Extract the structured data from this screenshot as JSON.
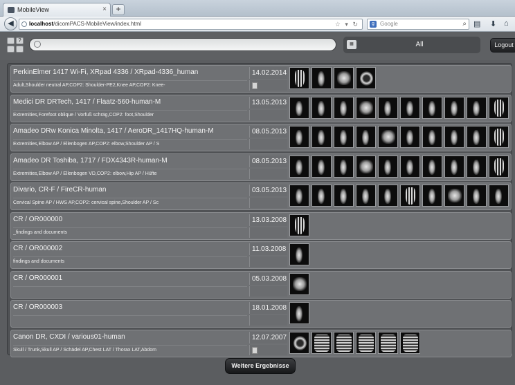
{
  "browser": {
    "tab_title": "MobileView",
    "tab_close": "×",
    "new_tab": "+",
    "url_host": "localhost",
    "url_path": "/dicomPACS-MobileView/index.html",
    "search_engine_label": "Google",
    "search_engine_icon": "google-icon"
  },
  "header": {
    "filter_label": "All",
    "logout_label": "Logout",
    "search_placeholder": ""
  },
  "studies": [
    {
      "title": "PerkinElmer 1417 Wi-Fi, XRpad 4336 / XRpad-4336_human",
      "description": "Adult,Shoulder neutral AP,COP2: Shoulder-PE2,Knee AP,COP2: Knee-",
      "date": "14.02.2014",
      "thumbnails": [
        "hand",
        "knee",
        "shoulder",
        "skull"
      ],
      "has_tag": true
    },
    {
      "title": "Medici DR DRTech, 1417 / Flaatz-560-human-M",
      "description": "Extremities,Forefoot oblique / Vorfuß schräg,COP2: foot,Shoulder",
      "date": "13.05.2013",
      "thumbnails": [
        "bone",
        "bone",
        "bone",
        "foot",
        "bone",
        "bone",
        "bone",
        "bone",
        "bone",
        "hand"
      ],
      "has_tag": false
    },
    {
      "title": "Amadeo DRw Konica Minolta, 1417 / AeroDR_1417HQ-human-M",
      "description": "Extremities,Elbow AP / Ellenbogen AP,COP2: elbow,Shoulder AP / S",
      "date": "08.05.2013",
      "thumbnails": [
        "bone",
        "bone",
        "bone",
        "bone",
        "foot",
        "bone",
        "bone",
        "bone",
        "bone",
        "hand"
      ],
      "has_tag": false
    },
    {
      "title": "Amadeo DR Toshiba, 1717 / FDX4343R-human-M",
      "description": "Extremities,Elbow AP / Ellenbogen VD,COP2: elbow,Hip AP / Hüfte",
      "date": "08.05.2013",
      "thumbnails": [
        "bone",
        "bone",
        "bone",
        "foot",
        "bone",
        "bone",
        "bone",
        "bone",
        "bone",
        "hand"
      ],
      "has_tag": false
    },
    {
      "title": "Divario, CR-F / FireCR-human",
      "description": "Cervical Spine AP / HWS AP,COP2: cervical spine,Shoulder AP / Sc",
      "date": "03.05.2013",
      "thumbnails": [
        "bone",
        "bone",
        "bone",
        "bone",
        "bone",
        "hand",
        "bone",
        "foot",
        "bone",
        "bone"
      ],
      "has_tag": false
    },
    {
      "title": "CR / OR000000",
      "description": "_findings and documents",
      "date": "13.03.2008",
      "thumbnails": [
        "hand"
      ],
      "has_tag": false
    },
    {
      "title": "CR / OR000002",
      "description": "findings and documents",
      "date": "11.03.2008",
      "thumbnails": [
        "bone"
      ],
      "has_tag": false
    },
    {
      "title": "CR / OR000001",
      "description": "",
      "date": "05.03.2008",
      "thumbnails": [
        "foot"
      ],
      "has_tag": false
    },
    {
      "title": "CR / OR000003",
      "description": "",
      "date": "18.01.2008",
      "thumbnails": [
        "bone"
      ],
      "has_tag": false
    },
    {
      "title": "Canon DR, CXDI / various01-human",
      "description": "Skull / Trunk,Skull AP / Schädel AP,Chest LAT / Thorax LAT,Abdom",
      "date": "12.07.2007",
      "thumbnails": [
        "skull",
        "chest",
        "chest",
        "chest",
        "chest",
        "chest"
      ],
      "has_tag": true
    }
  ],
  "more_label": "Weitere Ergebnisse"
}
